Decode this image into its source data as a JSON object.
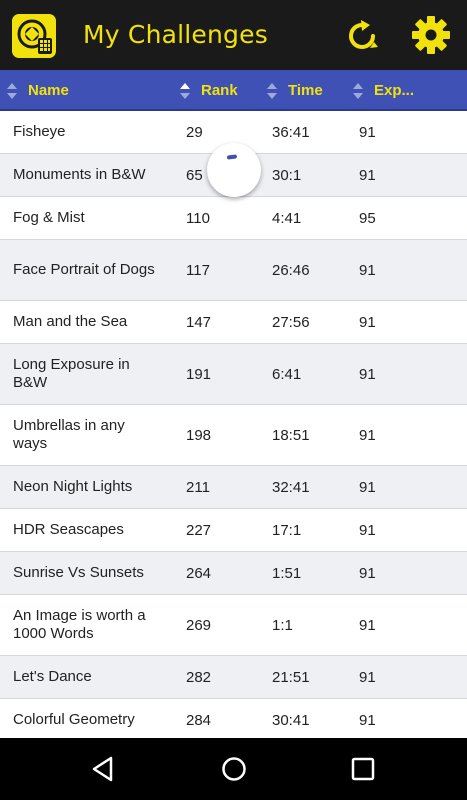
{
  "app": {
    "title": "My Challenges",
    "accent_color": "#f2e20c",
    "header_color": "#3f51b5",
    "logo_icon": "camera-logo-icon",
    "refresh_icon": "refresh-icon",
    "settings_icon": "gear-icon"
  },
  "table": {
    "columns": [
      "Name",
      "Rank",
      "Time",
      "Exp..."
    ],
    "rows": [
      {
        "name": "Fisheye",
        "rank": "29",
        "time": "36:41",
        "exp": "91"
      },
      {
        "name": "Monuments in B&W",
        "rank": "65",
        "time": "30:1",
        "exp": "91"
      },
      {
        "name": "Fog & Mist",
        "rank": "110",
        "time": "4:41",
        "exp": "95"
      },
      {
        "name": "Face Portrait of Dogs",
        "rank": "117",
        "time": "26:46",
        "exp": "91"
      },
      {
        "name": "Man and the Sea",
        "rank": "147",
        "time": "27:56",
        "exp": "91"
      },
      {
        "name": "Long Exposure in B&W",
        "rank": "191",
        "time": "6:41",
        "exp": "91"
      },
      {
        "name": "Umbrellas in any ways",
        "rank": "198",
        "time": "18:51",
        "exp": "91"
      },
      {
        "name": "Neon Night Lights",
        "rank": "211",
        "time": "32:41",
        "exp": "91"
      },
      {
        "name": "HDR Seascapes",
        "rank": "227",
        "time": "17:1",
        "exp": "91"
      },
      {
        "name": "Sunrise Vs Sunsets",
        "rank": "264",
        "time": "1:51",
        "exp": "91"
      },
      {
        "name": "An Image is worth a 1000 Words",
        "rank": "269",
        "time": "1:1",
        "exp": "91"
      },
      {
        "name": "Let's Dance",
        "rank": "282",
        "time": "21:51",
        "exp": "91"
      },
      {
        "name": "Colorful Geometry",
        "rank": "284",
        "time": "30:41",
        "exp": "91"
      }
    ]
  },
  "nav": {
    "back_icon": "back-triangle-icon",
    "home_icon": "home-circle-icon",
    "recents_icon": "recents-square-icon"
  }
}
